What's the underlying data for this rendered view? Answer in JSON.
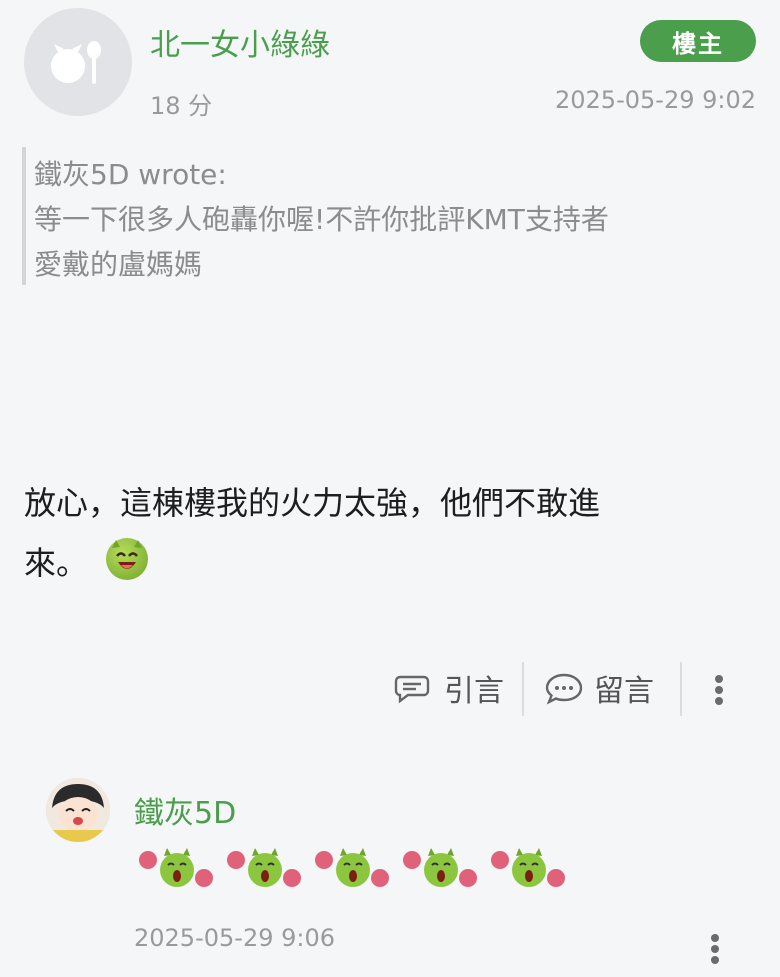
{
  "post": {
    "author": "北一女小綠綠",
    "badge": "樓主",
    "ago": "18 分",
    "timestamp": "2025-05-29 9:02",
    "quote": {
      "attribution": "鐵灰5D wrote:",
      "lines": [
        "等一下很多人砲轟你喔!不許你批評KMT支持者",
        "愛戴的盧媽媽"
      ]
    },
    "body_lines": [
      "放心，這棟樓我的火力太強，他們不敢進",
      "來。"
    ],
    "actions": {
      "quote_label": "引言",
      "comment_label": "留言"
    }
  },
  "reply": {
    "author": "鐵灰5D",
    "sticker_count": 5,
    "timestamp": "2025-05-29 9:06"
  },
  "colors": {
    "accent": "#4a9e4c",
    "muted": "#9a9a9a",
    "background": "#f5f6f8"
  },
  "icons": [
    "default-avatar-icon",
    "quote-bubble-icon",
    "comment-bubble-icon",
    "more-vertical-icon",
    "devil-grin-emoji-icon"
  ]
}
